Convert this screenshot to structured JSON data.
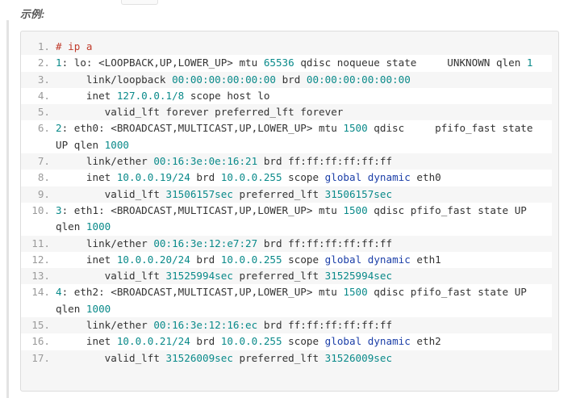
{
  "heading": "示例:",
  "colors": {
    "comment": "#c03b2b",
    "number": "#0a8a8a",
    "keyword": "#1c3fa8",
    "text": "#333333",
    "line_number": "#9a9a9a"
  },
  "code_lines": [
    {
      "n": "1.",
      "tokens": [
        [
          "cmt",
          "# ip a"
        ]
      ]
    },
    {
      "n": "2.",
      "tokens": [
        [
          "num",
          "1"
        ],
        [
          "plain",
          ": lo: <LOOPBACK,UP,LOWER_UP> mtu "
        ],
        [
          "num",
          "65536"
        ],
        [
          "plain",
          " qdisc noqueue state     UNKNOWN qlen "
        ],
        [
          "num",
          "1"
        ]
      ]
    },
    {
      "n": "3.",
      "tokens": [
        [
          "plain",
          "     link/loopback "
        ],
        [
          "num",
          "00:00:00:00:00:00"
        ],
        [
          "plain",
          " brd "
        ],
        [
          "num",
          "00:00:00:00:00:00"
        ]
      ]
    },
    {
      "n": "4.",
      "tokens": [
        [
          "plain",
          "     inet "
        ],
        [
          "num",
          "127.0.0.1/8"
        ],
        [
          "plain",
          " scope host lo"
        ]
      ]
    },
    {
      "n": "5.",
      "tokens": [
        [
          "plain",
          "        valid_lft forever preferred_lft forever"
        ]
      ]
    },
    {
      "n": "6.",
      "tokens": [
        [
          "num",
          "2"
        ],
        [
          "plain",
          ": eth0: <BROADCAST,MULTICAST,UP,LOWER_UP> mtu "
        ],
        [
          "num",
          "1500"
        ],
        [
          "plain",
          " qdisc     pfifo_fast state UP qlen "
        ],
        [
          "num",
          "1000"
        ]
      ]
    },
    {
      "n": "7.",
      "tokens": [
        [
          "plain",
          "     link/ether "
        ],
        [
          "num",
          "00:16:3e:0e:16:21"
        ],
        [
          "plain",
          " brd ff:ff:ff:ff:ff:ff"
        ]
      ]
    },
    {
      "n": "8.",
      "tokens": [
        [
          "plain",
          "     inet "
        ],
        [
          "num",
          "10.0.0.19/24"
        ],
        [
          "plain",
          " brd "
        ],
        [
          "num",
          "10.0.0.255"
        ],
        [
          "plain",
          " scope "
        ],
        [
          "kw",
          "global"
        ],
        [
          "plain",
          " "
        ],
        [
          "kw",
          "dynamic"
        ],
        [
          "plain",
          " eth0"
        ]
      ]
    },
    {
      "n": "9.",
      "tokens": [
        [
          "plain",
          "        valid_lft "
        ],
        [
          "num",
          "31506157sec"
        ],
        [
          "plain",
          " preferred_lft "
        ],
        [
          "num",
          "31506157sec"
        ]
      ]
    },
    {
      "n": "10.",
      "tokens": [
        [
          "num",
          "3"
        ],
        [
          "plain",
          ": eth1: <BROADCAST,MULTICAST,UP,LOWER_UP> mtu "
        ],
        [
          "num",
          "1500"
        ],
        [
          "plain",
          " qdisc pfifo_fast state UP qlen "
        ],
        [
          "num",
          "1000"
        ]
      ]
    },
    {
      "n": "11.",
      "tokens": [
        [
          "plain",
          "     link/ether "
        ],
        [
          "num",
          "00:16:3e:12:e7:27"
        ],
        [
          "plain",
          " brd ff:ff:ff:ff:ff:ff"
        ]
      ]
    },
    {
      "n": "12.",
      "tokens": [
        [
          "plain",
          "     inet "
        ],
        [
          "num",
          "10.0.0.20/24"
        ],
        [
          "plain",
          " brd "
        ],
        [
          "num",
          "10.0.0.255"
        ],
        [
          "plain",
          " scope "
        ],
        [
          "kw",
          "global"
        ],
        [
          "plain",
          " "
        ],
        [
          "kw",
          "dynamic"
        ],
        [
          "plain",
          " eth1"
        ]
      ]
    },
    {
      "n": "13.",
      "tokens": [
        [
          "plain",
          "        valid_lft "
        ],
        [
          "num",
          "31525994sec"
        ],
        [
          "plain",
          " preferred_lft "
        ],
        [
          "num",
          "31525994sec"
        ]
      ]
    },
    {
      "n": "14.",
      "tokens": [
        [
          "num",
          "4"
        ],
        [
          "plain",
          ": eth2: <BROADCAST,MULTICAST,UP,LOWER_UP> mtu "
        ],
        [
          "num",
          "1500"
        ],
        [
          "plain",
          " qdisc pfifo_fast state UP qlen "
        ],
        [
          "num",
          "1000"
        ]
      ]
    },
    {
      "n": "15.",
      "tokens": [
        [
          "plain",
          "     link/ether "
        ],
        [
          "num",
          "00:16:3e:12:16:ec"
        ],
        [
          "plain",
          " brd ff:ff:ff:ff:ff:ff"
        ]
      ]
    },
    {
      "n": "16.",
      "tokens": [
        [
          "plain",
          "     inet "
        ],
        [
          "num",
          "10.0.0.21/24"
        ],
        [
          "plain",
          " brd "
        ],
        [
          "num",
          "10.0.0.255"
        ],
        [
          "plain",
          " scope "
        ],
        [
          "kw",
          "global"
        ],
        [
          "plain",
          " "
        ],
        [
          "kw",
          "dynamic"
        ],
        [
          "plain",
          " eth2"
        ]
      ]
    },
    {
      "n": "17.",
      "tokens": [
        [
          "plain",
          "        valid_lft "
        ],
        [
          "num",
          "31526009sec"
        ],
        [
          "plain",
          " preferred_lft "
        ],
        [
          "num",
          "31526009sec"
        ]
      ]
    }
  ]
}
